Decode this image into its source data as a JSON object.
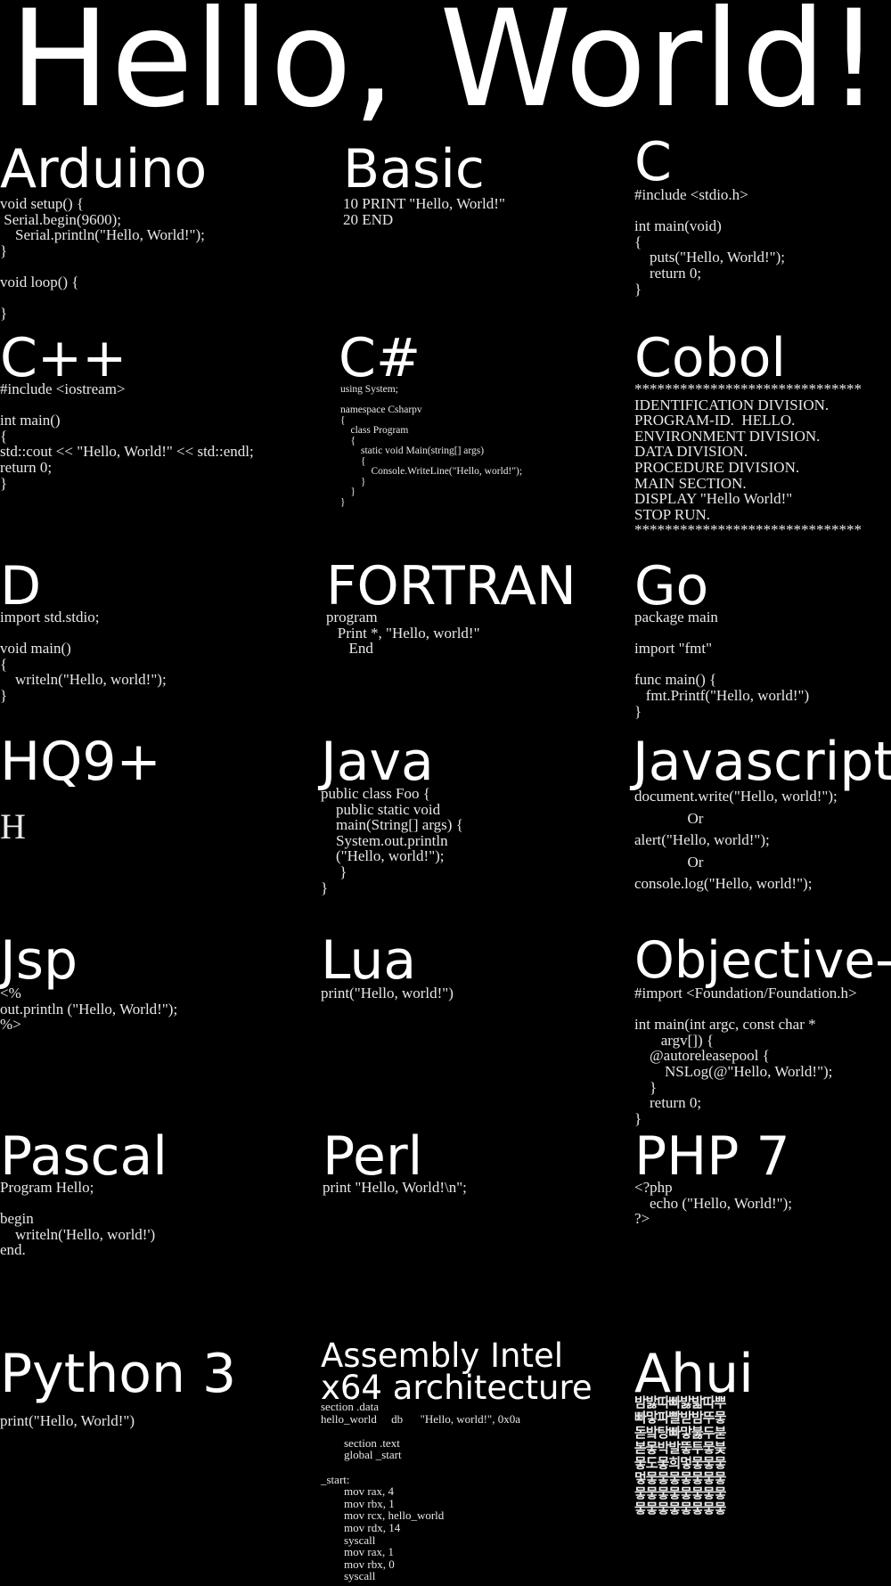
{
  "title": "Hello, World!",
  "languages": [
    {
      "name": "Arduino",
      "code": "void setup() {\n Serial.begin(9600);\n    Serial.println(\"Hello, World!\");\n}\n\nvoid loop() {\n\n}"
    },
    {
      "name": "Basic",
      "code": "10 PRINT \"Hello, World!\"\n20 END"
    },
    {
      "name": "C",
      "code": "#include <stdio.h>\n\nint main(void)\n{\n    puts(\"Hello, World!\");\n    return 0;\n}"
    },
    {
      "name": "C++",
      "code": "#include <iostream>\n\nint main()\n{\nstd::cout << \"Hello, World!\" << std::endl;\nreturn 0;\n}"
    },
    {
      "name": "C#",
      "code": "using System;\n\nnamespace Csharpv\n{\n    class Program\n    {\n        static void Main(string[] args)\n        {\n            Console.WriteLine(\"Hello, world!\");\n        }\n    }\n}"
    },
    {
      "name": "Cobol",
      "code": "******************************\nIDENTIFICATION DIVISION.\nPROGRAM-ID.  HELLO.\nENVIRONMENT DIVISION.\nDATA DIVISION.\nPROCEDURE DIVISION.\nMAIN SECTION.\nDISPLAY \"Hello World!\"\nSTOP RUN.\n******************************"
    },
    {
      "name": "D",
      "code": "import std.stdio;\n\nvoid main()\n{\n    writeln(\"Hello, world!\");\n}"
    },
    {
      "name": "FORTRAN",
      "code": "program\n   Print *, \"Hello, world!\"\n      End"
    },
    {
      "name": "Go",
      "code": "package main\n\nimport \"fmt\"\n\nfunc main() {\n   fmt.Printf(\"Hello, world!\")\n}"
    },
    {
      "name": "HQ9+",
      "code": "H"
    },
    {
      "name": "Java",
      "code": "public class Foo {\n    public static void\n    main(String[] args) {\n    System.out.println\n    (\"Hello, world!\");\n     }\n}"
    },
    {
      "name": "Javascript",
      "code": "document.write(\"Hello, world!\");\n              Or\nalert(\"Hello, world!\");\n              Or\nconsole.log(\"Hello, world!\");"
    },
    {
      "name": "Jsp",
      "code": "<%\nout.println (\"Hello, World!\");\n%>"
    },
    {
      "name": "Lua",
      "code": "print(\"Hello, world!\")"
    },
    {
      "name": "Objective-C",
      "code": "#import <Foundation/Foundation.h>\n\nint main(int argc, const char *\n       argv[]) {\n    @autoreleasepool {\n        NSLog(@\"Hello, World!\");\n    }\n    return 0;\n}"
    },
    {
      "name": "Pascal",
      "code": "Program Hello;\n\nbegin\n    writeln('Hello, world!')\nend."
    },
    {
      "name": "Perl",
      "code": "print \"Hello, World!\\n\";"
    },
    {
      "name": "PHP 7",
      "code": "<?php\n    echo (\"Hello, World!\");\n?>"
    },
    {
      "name": "Python 3",
      "code": "print(\"Hello, World!\")"
    },
    {
      "name": "Assembly Intel\nx64 architecture",
      "code": "section .data\nhello_world     db      \"Hello, world!\", 0x0a\n\n        section .text\n        global _start\n\n_start:\n        mov rax, 4\n        mov rbx, 1\n        mov rcx, hello_world\n        mov rdx, 14\n        syscall\n        mov rax, 1\n        mov rbx, 0\n        syscall"
    },
    {
      "name": "Ahui",
      "code": "밤밣따빠밣밟따뿌\n빠맣파빨받밤뚜뭏\n돋밬탕빠맣붏두붇\n볻뫃박발뚷투뭏붖\n뫃도뫃희멓뭏뭏뭏\n멓뭏뭏뭏뭏뭏뭏뭏\n뭏뭏뭏뭏뭏뭏뭏뭏\n뭏뭏뭏뭏뭏뭏뭏뭏"
    }
  ]
}
